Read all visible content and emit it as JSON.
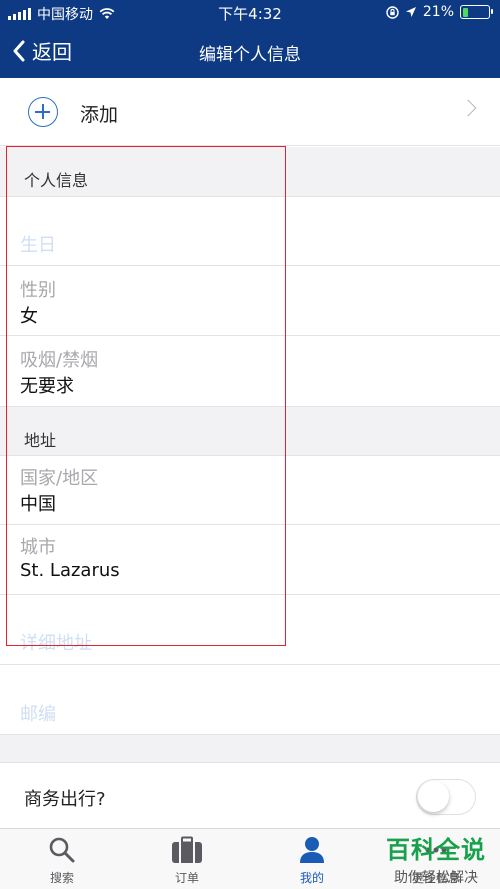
{
  "status_bar": {
    "carrier": "中国移动",
    "time": "下午4:32",
    "battery": "21%",
    "battery_level": 0.21
  },
  "nav": {
    "back_label": "返回",
    "title": "编辑个人信息"
  },
  "add_row": {
    "label": "添加"
  },
  "sections": {
    "personal": {
      "header": "个人信息",
      "birthday_label": "生日",
      "gender_label": "性别",
      "gender_value": "女",
      "smoking_label": "吸烟/禁烟",
      "smoking_value": "无要求"
    },
    "address": {
      "header": "地址",
      "country_label": "国家/地区",
      "country_value": "中国",
      "city_label": "城市",
      "city_value": "St. Lazarus",
      "detail_label": "详细地址",
      "postcode_label": "邮编"
    }
  },
  "business_travel": {
    "label": "商务出行?",
    "enabled": false
  },
  "tabs": [
    {
      "label": "搜索",
      "icon": "search-icon"
    },
    {
      "label": "订单",
      "icon": "briefcase-icon"
    },
    {
      "label": "我的",
      "icon": "person-icon"
    },
    {
      "label": "更多信息",
      "icon": "more-icon"
    }
  ],
  "watermark": {
    "title": "百科全说",
    "subtitle": "助你轻松解决"
  },
  "colors": {
    "nav_bg": "#0e3a84",
    "accent": "#1a5bb5",
    "highlight_box": "#e0232f",
    "watermark_green": "#19a04b"
  }
}
